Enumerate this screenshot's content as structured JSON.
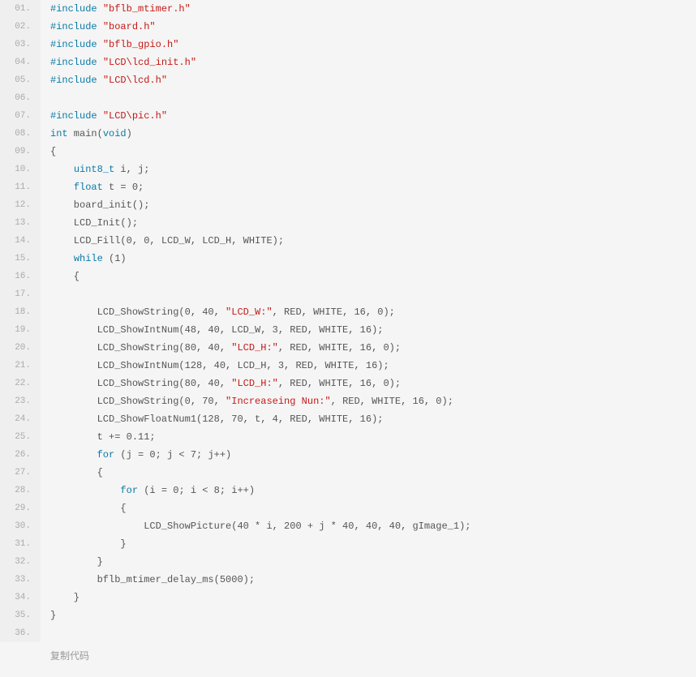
{
  "code_lines": [
    {
      "n": "01.",
      "html": "<span class=\"kw\">#include</span> <span class=\"str\">\"bflb_mtimer.h\"</span>"
    },
    {
      "n": "02.",
      "html": "<span class=\"kw\">#include</span> <span class=\"str\">\"board.h\"</span>"
    },
    {
      "n": "03.",
      "html": "<span class=\"kw\">#include</span> <span class=\"str\">\"bflb_gpio.h\"</span>"
    },
    {
      "n": "04.",
      "html": "<span class=\"kw\">#include</span> <span class=\"str\">\"LCD\\lcd_init.h\"</span>"
    },
    {
      "n": "05.",
      "html": "<span class=\"kw\">#include</span> <span class=\"str\">\"LCD\\lcd.h\"</span>"
    },
    {
      "n": "06.",
      "html": ""
    },
    {
      "n": "07.",
      "html": "<span class=\"kw\">#include</span> <span class=\"str\">\"LCD\\pic.h\"</span>"
    },
    {
      "n": "08.",
      "html": "<span class=\"type\">int</span> main(<span class=\"type\">void</span>)"
    },
    {
      "n": "09.",
      "html": "{"
    },
    {
      "n": "10.",
      "html": "    <span class=\"type\">uint8_t</span> i, j;"
    },
    {
      "n": "11.",
      "html": "    <span class=\"type\">float</span> t = 0;"
    },
    {
      "n": "12.",
      "html": "    board_init();"
    },
    {
      "n": "13.",
      "html": "    LCD_Init();"
    },
    {
      "n": "14.",
      "html": "    LCD_Fill(0, 0, LCD_W, LCD_H, WHITE);"
    },
    {
      "n": "15.",
      "html": "    <span class=\"kw\">while</span> (1)"
    },
    {
      "n": "16.",
      "html": "    {"
    },
    {
      "n": "17.",
      "html": ""
    },
    {
      "n": "18.",
      "html": "        LCD_ShowString(0, 40, <span class=\"str\">\"LCD_W:\"</span>, RED, WHITE, 16, 0);"
    },
    {
      "n": "19.",
      "html": "        LCD_ShowIntNum(48, 40, LCD_W, 3, RED, WHITE, 16);"
    },
    {
      "n": "20.",
      "html": "        LCD_ShowString(80, 40, <span class=\"str\">\"LCD_H:\"</span>, RED, WHITE, 16, 0);"
    },
    {
      "n": "21.",
      "html": "        LCD_ShowIntNum(128, 40, LCD_H, 3, RED, WHITE, 16);"
    },
    {
      "n": "22.",
      "html": "        LCD_ShowString(80, 40, <span class=\"str\">\"LCD_H:\"</span>, RED, WHITE, 16, 0);"
    },
    {
      "n": "23.",
      "html": "        LCD_ShowString(0, 70, <span class=\"str\">\"Increaseing Nun:\"</span>, RED, WHITE, 16, 0);"
    },
    {
      "n": "24.",
      "html": "        LCD_ShowFloatNum1(128, 70, t, 4, RED, WHITE, 16);"
    },
    {
      "n": "25.",
      "html": "        t += 0.11;"
    },
    {
      "n": "26.",
      "html": "        <span class=\"kw\">for</span> (j = 0; j &lt; 7; j++)"
    },
    {
      "n": "27.",
      "html": "        {"
    },
    {
      "n": "28.",
      "html": "            <span class=\"kw\">for</span> (i = 0; i &lt; 8; i++)"
    },
    {
      "n": "29.",
      "html": "            {"
    },
    {
      "n": "30.",
      "html": "                LCD_ShowPicture(40 * i, 200 + j * 40, 40, 40, gImage_1);"
    },
    {
      "n": "31.",
      "html": "            }"
    },
    {
      "n": "32.",
      "html": "        }"
    },
    {
      "n": "33.",
      "html": "        bflb_mtimer_delay_ms(5000);"
    },
    {
      "n": "34.",
      "html": "    }"
    },
    {
      "n": "35.",
      "html": "}"
    },
    {
      "n": "36.",
      "html": ""
    }
  ],
  "copy_label": "复制代码"
}
